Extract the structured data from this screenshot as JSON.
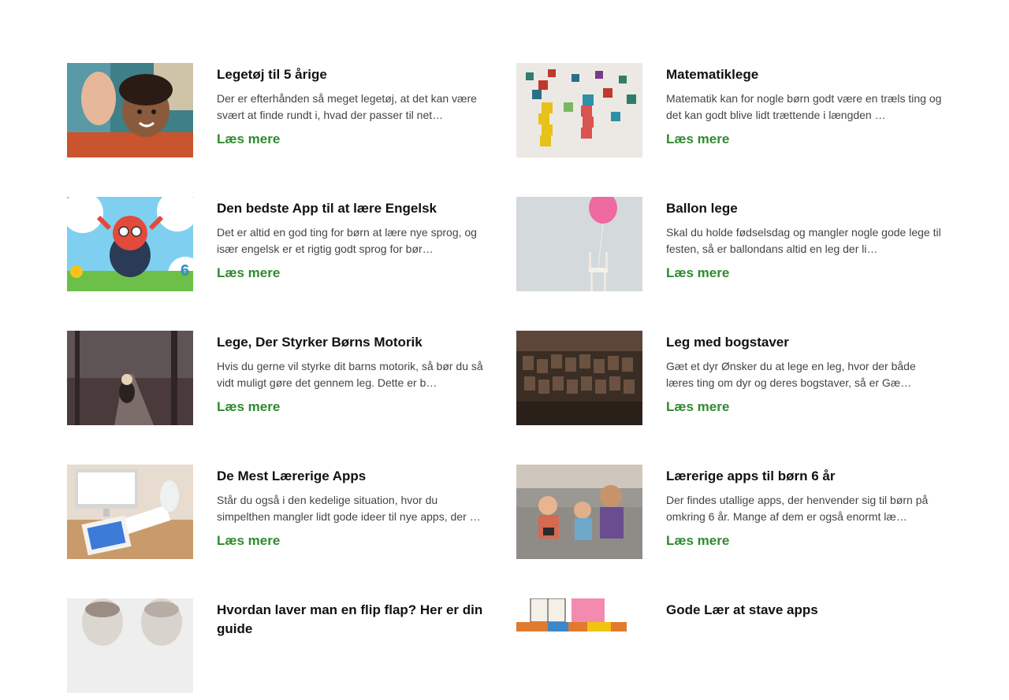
{
  "cards": [
    {
      "title": "Legetøj til 5 årige",
      "excerpt": "Der er efterhånden så meget legetøj, at det kan være svært at finde rundt i, hvad der passer til net…",
      "more": "Læs mere",
      "image": "girl-high-five-photo"
    },
    {
      "title": "Matematiklege",
      "excerpt": "Matematik kan for nogle børn godt være en træls ting og det kan godt blive lidt trættende i længden …",
      "more": "Læs mere",
      "image": "number-cubes-photo"
    },
    {
      "title": "Den bedste App til at lære Engelsk",
      "excerpt": "Det er altid en god ting for børn at lære nye sprog, og især engelsk er et rigtig godt sprog for bør…",
      "more": "Læs mere",
      "image": "red-monster-app-illustration"
    },
    {
      "title": "Ballon lege",
      "excerpt": "Skal du holde fødselsdag og mangler nogle gode lege til festen, så er ballondans altid en leg der li…",
      "more": "Læs mere",
      "image": "balloon-chair-photo"
    },
    {
      "title": "Lege, Der Styrker Børns Motorik",
      "excerpt": "Hvis du gerne vil styrke dit barns motorik, så bør du så vidt muligt gøre det gennem leg. Dette er b…",
      "more": "Læs mere",
      "image": "child-forest-path-photo"
    },
    {
      "title": "Leg med bogstaver",
      "excerpt": "Gæt et dyr Ønsker du at lege en leg, hvor der både læres ting om dyr og deres bogstaver, så er Gæ…",
      "more": "Læs mere",
      "image": "letterpress-blocks-photo"
    },
    {
      "title": "De Mest Lærerige Apps",
      "excerpt": "Står du også i den kedelige situation, hvor du simpelthen mangler lidt gode ideer til nye apps, der …",
      "more": "Læs mere",
      "image": "desk-tablet-photo"
    },
    {
      "title": "Lærerige apps til børn 6 år",
      "excerpt": "Der findes utallige apps, der henvender sig til børn på omkring 6 år. Mange af dem er også enormt læ…",
      "more": "Læs mere",
      "image": "kids-couch-tablets-photo"
    },
    {
      "title": "Hvordan laver man en flip flap? Her er din guide",
      "excerpt": "",
      "more": "",
      "image": "two-boys-photo"
    },
    {
      "title": "Gode Lær at stave apps",
      "excerpt": "",
      "more": "",
      "image": "letter-blocks-photo"
    }
  ]
}
